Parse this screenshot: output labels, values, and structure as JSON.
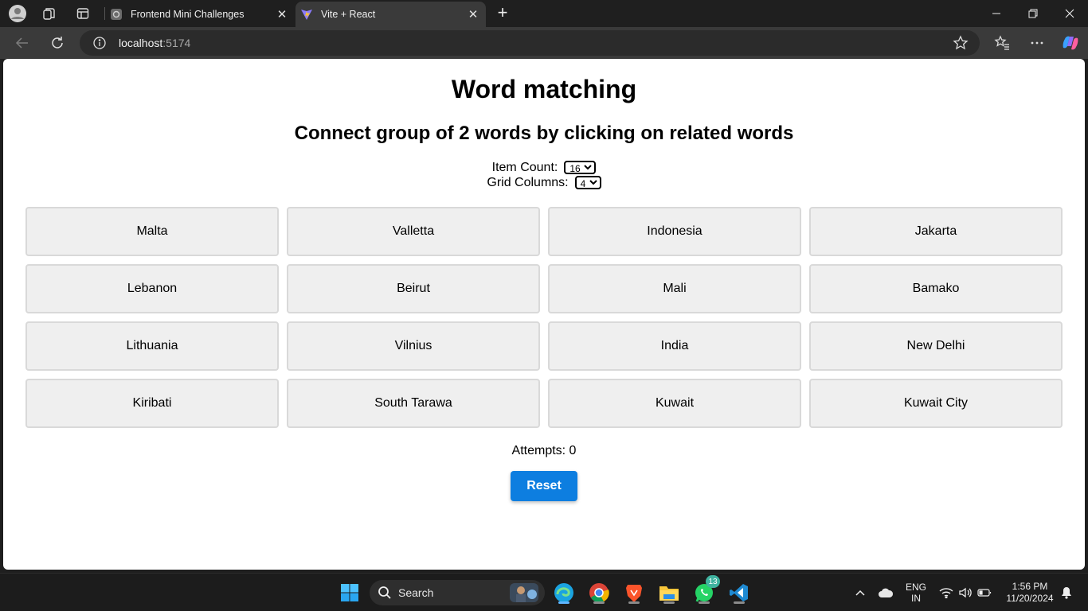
{
  "browser": {
    "tabs": [
      {
        "title": "Frontend Mini Challenges",
        "active": false
      },
      {
        "title": "Vite + React",
        "active": true
      }
    ],
    "url": {
      "host": "localhost",
      "port": ":5174"
    }
  },
  "app": {
    "title": "Word matching",
    "subtitle": "Connect group of 2 words by clicking on related words",
    "item_count_label": "Item Count:",
    "item_count_value": "16",
    "grid_columns_label": "Grid Columns:",
    "grid_columns_value": "4",
    "words": [
      "Malta",
      "Valletta",
      "Indonesia",
      "Jakarta",
      "Lebanon",
      "Beirut",
      "Mali",
      "Bamako",
      "Lithuania",
      "Vilnius",
      "India",
      "New Delhi",
      "Kiribati",
      "South Tarawa",
      "Kuwait",
      "Kuwait City"
    ],
    "attempts_text": "Attempts: 0",
    "reset_label": "Reset"
  },
  "taskbar": {
    "search_label": "Search",
    "whatsapp_badge": "13",
    "lang_line1": "ENG",
    "lang_line2": "IN",
    "time": "1:56 PM",
    "date": "11/20/2024"
  },
  "colors": {
    "accent": "#0d7ee0",
    "card_bg": "#efefef",
    "card_border": "#d9d9d9"
  }
}
